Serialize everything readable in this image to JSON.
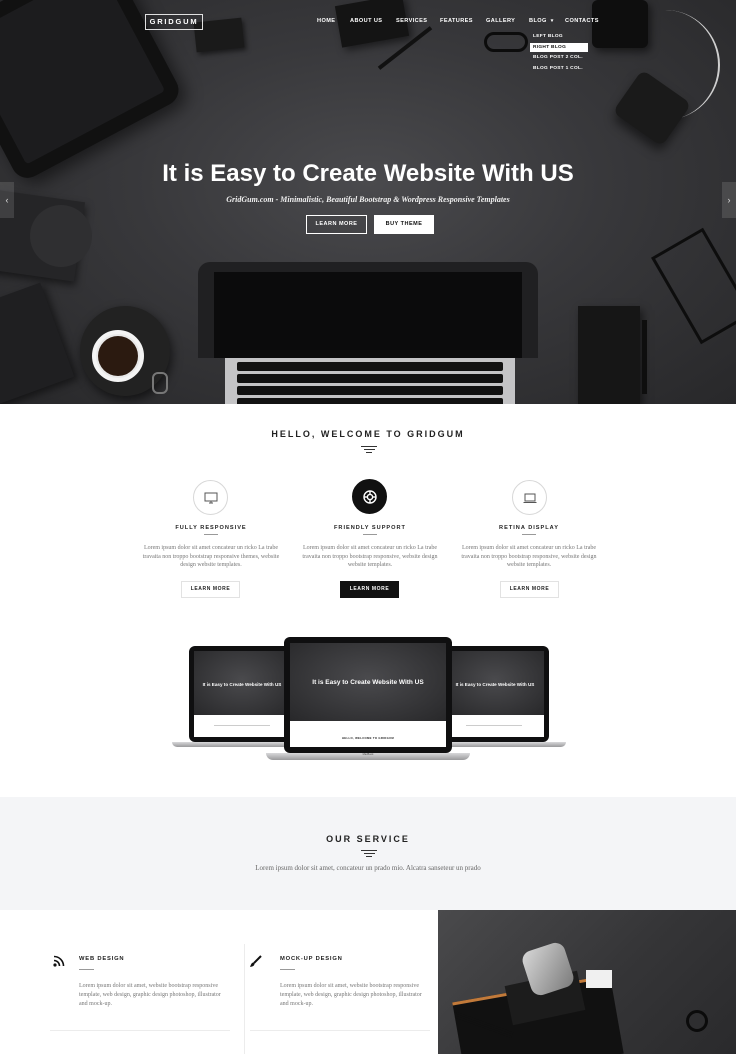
{
  "brand": {
    "logo": "GRIDGUM"
  },
  "nav": {
    "items": [
      {
        "label": "HOME"
      },
      {
        "label": "ABOUT US"
      },
      {
        "label": "SERVICES"
      },
      {
        "label": "FEATURES"
      },
      {
        "label": "GALLERY"
      },
      {
        "label": "BLOG",
        "has_dropdown": true
      },
      {
        "label": "CONTACTS"
      }
    ],
    "blog_dropdown": [
      {
        "label": "LEFT BLOG"
      },
      {
        "label": "RIGHT BLOG",
        "active": true
      },
      {
        "label": "BLOG POST 2 COL."
      },
      {
        "label": "BLOG POST 1 COL."
      }
    ]
  },
  "hero": {
    "title": "It is Easy to Create Website With US",
    "subtitle": "GridGum.com - Minimalistic, Beautiful Bootstrap & Wordpress Responsive Templates",
    "btn_learn": "LEARN MORE",
    "btn_buy": "BUY THEME",
    "arrow_prev": "‹",
    "arrow_next": "›"
  },
  "welcome": {
    "title": "HELLO, WELCOME TO GRIDGUM",
    "features": [
      {
        "icon": "monitor-icon",
        "title": "FULLY RESPONSIVE",
        "text": "Lorem ipsum dolor sit amet concateur un ricko La trabe travaita non troppo bootstrap responsive themes, website design website templates.",
        "button": "LEARN MORE"
      },
      {
        "icon": "lifebuoy-icon",
        "title": "FRIENDLY SUPPORT",
        "text": "Lorem ipsum dolor sit amet concateur un ricko La trabe travaita non troppo bootstrap responsive, website design website templates.",
        "button": "LEARN MORE",
        "highlight": true
      },
      {
        "icon": "laptop-icon",
        "title": "RETINA DISPLAY",
        "text": "Lorem ipsum dolor sit amet concateur un ricko La trabe travaita non troppo bootstrap responsive, website design website templates.",
        "button": "LEARN MORE"
      }
    ]
  },
  "devices": {
    "hero_title": "It is Easy to Create Website With US",
    "welcome_caption": "HELLO, WELCOME TO GRIDGUM",
    "laptop_label": "MacBook"
  },
  "service": {
    "title": "OUR SERVICE",
    "text": "Lorem ipsum dolor sit amet, concateur un prado mio. Alcatra sanseteur un prado",
    "items": [
      {
        "icon": "rss-icon",
        "title": "WEB DESIGN",
        "text": "Lorem ipsum dolor sit amet, website bootstrap responsive template, web design, graphic design photoshop, illustrator and mock-up."
      },
      {
        "icon": "brush-icon",
        "title": "MOCK-UP DESIGN",
        "text": "Lorem ipsum dolor sit amet, website bootstrap responsive template, web design, graphic design photoshop, illustrator and mock-up."
      }
    ]
  },
  "colors": {
    "dark": "#111111",
    "hero_bg": "#38383b",
    "band_bg": "#f4f5f7",
    "muted_text": "#777777"
  }
}
